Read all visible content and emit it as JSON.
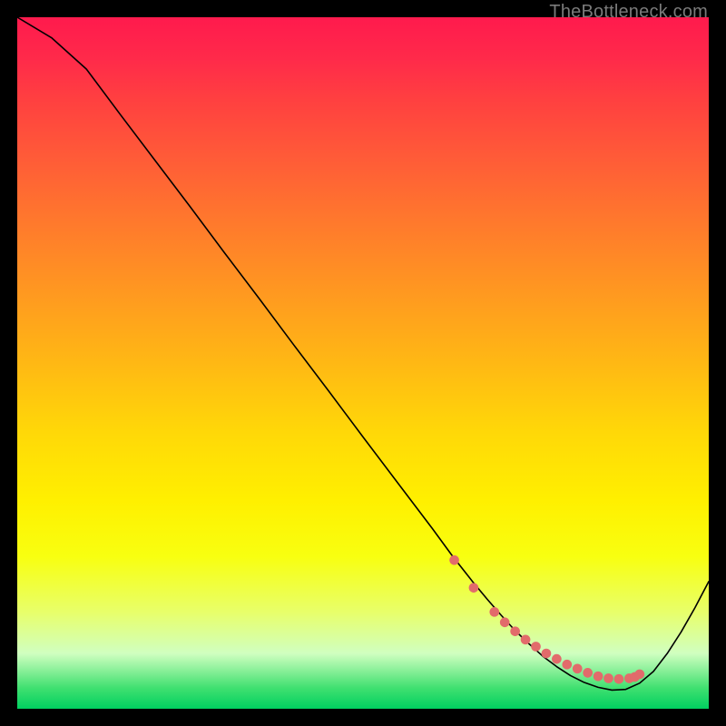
{
  "watermark": "TheBottleneck.com",
  "chart_data": {
    "type": "line",
    "title": "",
    "xlabel": "",
    "ylabel": "",
    "xlim": [
      0,
      100
    ],
    "ylim": [
      0,
      100
    ],
    "grid": false,
    "series": [
      {
        "name": "curve",
        "color": "#000000",
        "x": [
          0,
          5,
          10,
          15,
          20,
          25,
          30,
          35,
          40,
          45,
          50,
          55,
          60,
          63,
          66,
          68,
          70,
          72,
          74,
          76,
          78,
          80,
          82,
          84,
          86,
          88,
          90,
          92,
          94,
          96,
          98,
          100
        ],
        "y": [
          100,
          97,
          92.5,
          85.8,
          79.2,
          72.6,
          65.9,
          59.3,
          52.6,
          46.0,
          39.3,
          32.7,
          26.1,
          22.0,
          18.2,
          15.8,
          13.5,
          11.3,
          9.4,
          7.6,
          6.1,
          4.8,
          3.8,
          3.1,
          2.7,
          2.8,
          3.7,
          5.4,
          8.0,
          11.1,
          14.6,
          18.4
        ]
      }
    ],
    "markers": {
      "name": "highlight-points",
      "color": "#e26b6b",
      "radius_fraction": 0.007,
      "x": [
        63.2,
        66.0,
        69.0,
        70.5,
        72.0,
        73.5,
        75.0,
        76.5,
        78.0,
        79.5,
        81.0,
        82.5,
        84.0,
        85.5,
        87.0,
        88.5,
        89.3,
        90.0
      ],
      "y": [
        21.5,
        17.5,
        14.0,
        12.5,
        11.2,
        10.0,
        9.0,
        8.0,
        7.2,
        6.4,
        5.8,
        5.2,
        4.7,
        4.4,
        4.3,
        4.4,
        4.6,
        5.0
      ]
    }
  }
}
